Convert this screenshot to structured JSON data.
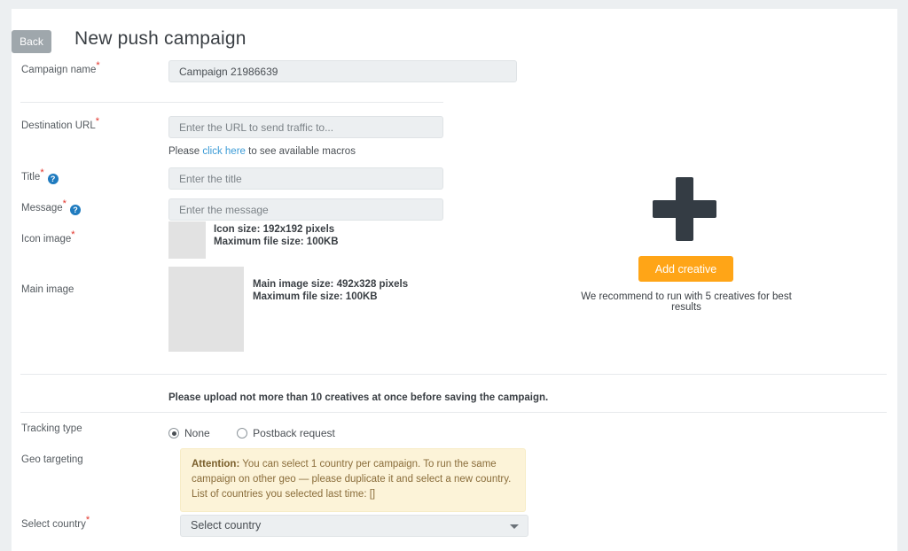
{
  "header": {
    "back_label": "Back",
    "title": "New push campaign"
  },
  "form": {
    "campaign_name": {
      "label": "Campaign name",
      "required": true,
      "value": "Campaign 21986639"
    },
    "destination_url": {
      "label": "Destination URL",
      "required": true,
      "placeholder": "Enter the URL to send traffic to...",
      "value": ""
    },
    "macros_hint": {
      "before": "Please ",
      "link": "click here",
      "after": " to see available macros"
    },
    "title_field": {
      "label": "Title",
      "required": true,
      "has_help": true,
      "help_glyph": "?",
      "placeholder": "Enter the title",
      "value": ""
    },
    "message_field": {
      "label": "Message",
      "required": true,
      "has_help": true,
      "help_glyph": "?",
      "placeholder": "Enter the message",
      "value": ""
    },
    "icon_image": {
      "label": "Icon image",
      "required": true,
      "meta_line1": "Icon size: 192x192 pixels",
      "meta_line2": "Maximum file size: 100KB"
    },
    "main_image": {
      "label": "Main image",
      "required": false,
      "meta_line1": "Main image size: 492x328 pixels",
      "meta_line2": "Maximum file size: 100KB"
    },
    "upload_note": "Please upload not more than 10 creatives at once before saving the campaign.",
    "tracking_type": {
      "label": "Tracking type",
      "options": [
        {
          "label": "None",
          "selected": true
        },
        {
          "label": "Postback request",
          "selected": false
        }
      ]
    },
    "geo_targeting": {
      "label": "Geo targeting",
      "attention_label": "Attention:",
      "attention_text": " You can select 1 country per campaign. To run the same campaign on other geo — please duplicate it and select a new country. List of countries you selected last time: []"
    },
    "select_country": {
      "label": "Select country",
      "required": true,
      "value": "Select country"
    }
  },
  "creative_panel": {
    "plus_icon": "plus-icon",
    "add_button": "Add creative",
    "recommendation": "We recommend to run with 5 creatives for best results"
  },
  "colors": {
    "accent_orange": "#ffa517",
    "link_blue": "#3b9bd6",
    "required_red": "#e2332a",
    "help_blue": "#1f7bbf",
    "attention_bg": "#fcf3d8",
    "attention_text": "#8a6d3b",
    "back_gray": "#9fa7ac",
    "field_bg": "#eceff1",
    "page_bg": "#eceff1"
  }
}
